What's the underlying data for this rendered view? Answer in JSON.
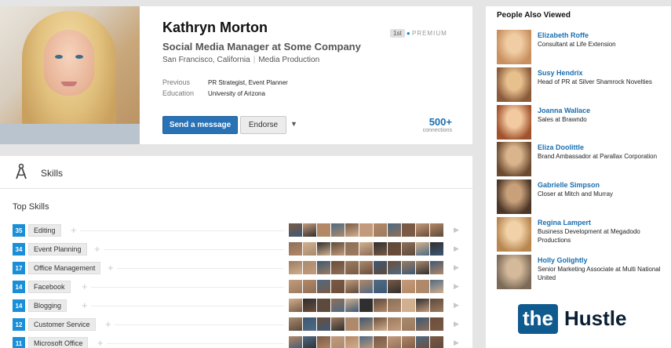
{
  "profile": {
    "name": "Kathryn Morton",
    "headline": "Social Media Manager at Some Company",
    "location": "San Francisco, California",
    "industry": "Media Production",
    "previous_label": "Previous",
    "previous_value": "PR Strategist, Event Planner",
    "education_label": "Education",
    "education_value": "University of Arizona",
    "degree": "1st",
    "premium": "PREMIUM",
    "send_message_label": "Send a message",
    "endorse_label": "Endorse",
    "connections_count": "500+",
    "connections_label": "connections"
  },
  "skills": {
    "title": "Skills",
    "top_skills_label": "Top Skills",
    "items": [
      {
        "count": "35",
        "name": "Editing"
      },
      {
        "count": "34",
        "name": "Event Planning"
      },
      {
        "count": "17",
        "name": "Office Management"
      },
      {
        "count": "14",
        "name": "Facebook"
      },
      {
        "count": "14",
        "name": "Blogging"
      },
      {
        "count": "12",
        "name": "Customer Service"
      },
      {
        "count": "11",
        "name": "Microsoft Office"
      }
    ]
  },
  "people_also_viewed": {
    "title": "People Also Viewed",
    "items": [
      {
        "name": "Elizabeth Roffe",
        "role": "Consultant at Life Extension"
      },
      {
        "name": "Susy Hendrix",
        "role": "Head of PR at Silver Shamrock Novelties"
      },
      {
        "name": "Joanna Wallace",
        "role": "Sales at Brawndo"
      },
      {
        "name": "Eliza Doolittle",
        "role": "Brand Ambassador at Parallax Corporation"
      },
      {
        "name": "Gabrielle Simpson",
        "role": "Closer at Mitch and Murray"
      },
      {
        "name": "Regina Lampert",
        "role": "Business Development at Megadodo Productions"
      },
      {
        "name": "Holly Golightly",
        "role": "Senior Marketing Associate at Multi National United"
      }
    ]
  },
  "logo": {
    "the": "the",
    "word": "Hustle"
  },
  "colors": {
    "accent": "#2872b5",
    "skill_count": "#1a8fd8",
    "link": "#1a6fb0",
    "logo_box": "#0f5a8f"
  }
}
